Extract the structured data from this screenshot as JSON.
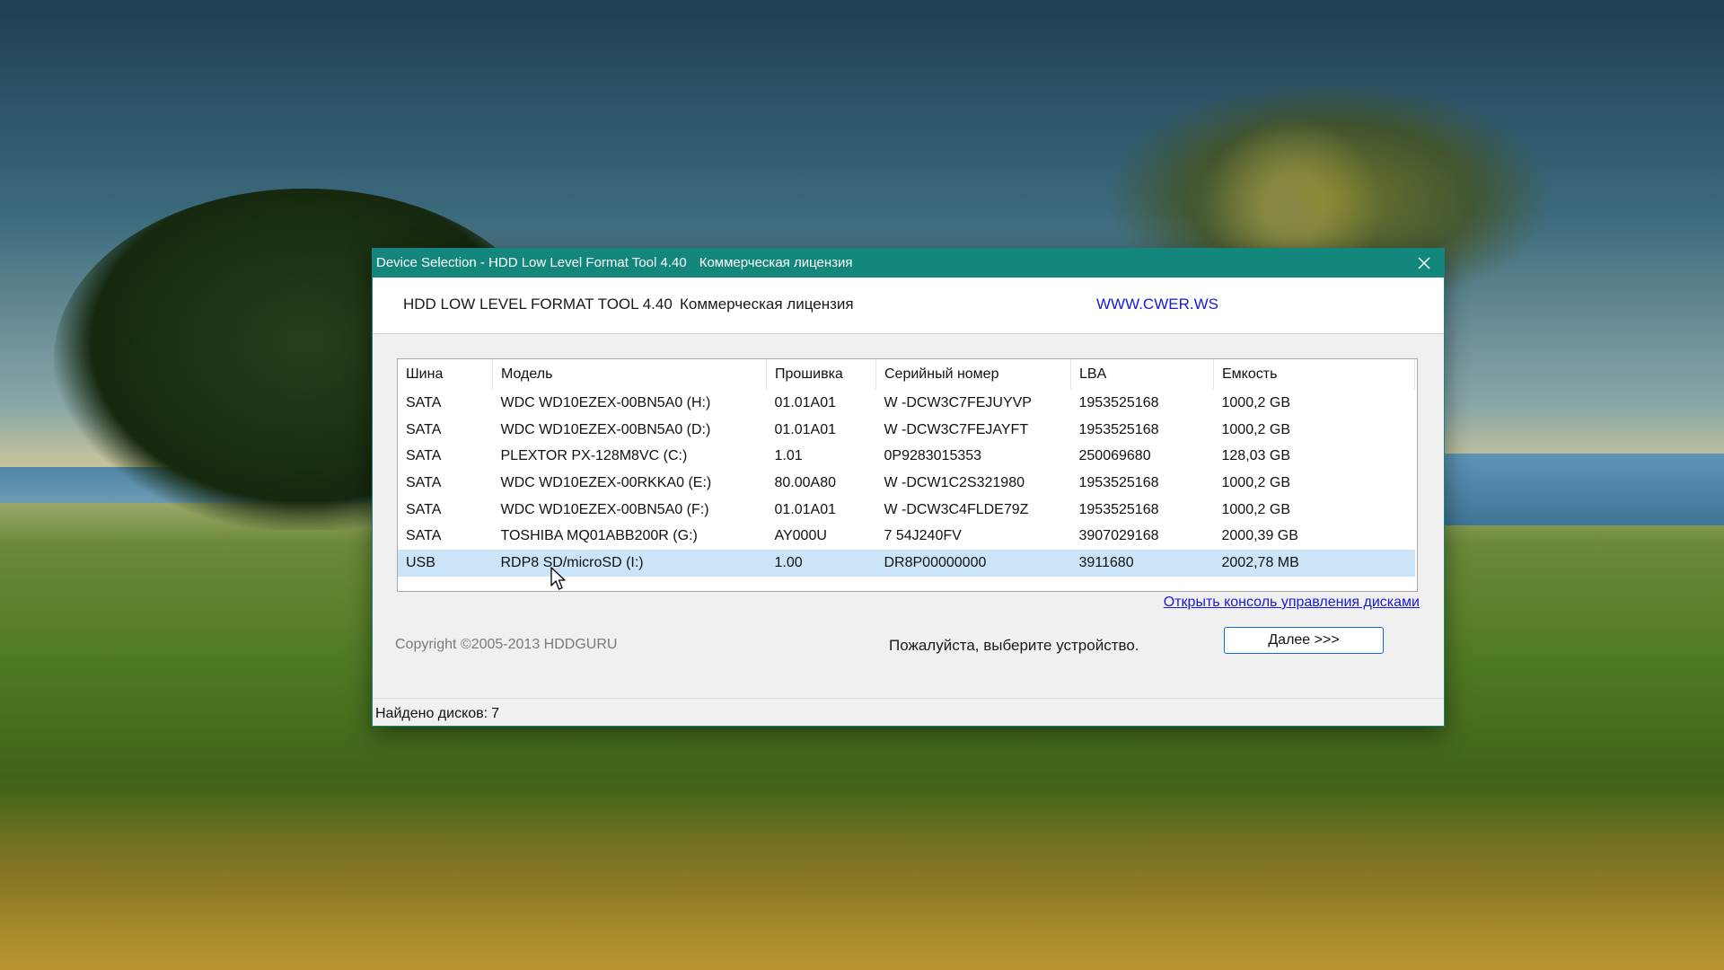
{
  "window": {
    "title": "Device Selection - HDD Low Level Format Tool 4.40",
    "title_license": "Коммерческая лицензия"
  },
  "header": {
    "app_name": "HDD LOW LEVEL FORMAT TOOL 4.40",
    "license": "Коммерческая лицензия",
    "site": "WWW.CWER.WS"
  },
  "table": {
    "columns": [
      "Шина",
      "Модель",
      "Прошивка",
      "Серийный номер",
      "LBA",
      "Емкость"
    ],
    "rows": [
      [
        "SATA",
        "WDC WD10EZEX-00BN5A0 (H:)",
        "01.01A01",
        "W -DCW3C7FEJUYVP",
        "1953525168",
        "1000,2 GB"
      ],
      [
        "SATA",
        "WDC WD10EZEX-00BN5A0 (D:)",
        "01.01A01",
        "W -DCW3C7FEJAYFT",
        "1953525168",
        "1000,2 GB"
      ],
      [
        "SATA",
        "PLEXTOR PX-128M8VC (C:)",
        "1.01",
        "0P9283015353",
        "250069680",
        "128,03 GB"
      ],
      [
        "SATA",
        "WDC WD10EZEX-00RKKA0 (E:)",
        "80.00A80",
        "W -DCW1C2S321980",
        "1953525168",
        "1000,2 GB"
      ],
      [
        "SATA",
        "WDC WD10EZEX-00BN5A0 (F:)",
        "01.01A01",
        "W -DCW3C4FLDE79Z",
        "1953525168",
        "1000,2 GB"
      ],
      [
        "SATA",
        "TOSHIBA MQ01ABB200R (G:)",
        "AY000U",
        "7 54J240FV",
        "3907029168",
        "2000,39 GB"
      ],
      [
        "USB",
        "RDP8 SD/microSD (I:)",
        "1.00",
        "DR8P00000000",
        "3911680",
        "2002,78 MB"
      ]
    ]
  },
  "links": {
    "disk_management": "Открыть консоль управления дисками"
  },
  "footer": {
    "copyright": "Copyright ©2005-2013 HDDGURU",
    "prompt": "Пожалуйста, выберите устройство.",
    "next_button": "Далее >>>"
  },
  "status": {
    "label": "Найдено дисков:",
    "count": "7"
  },
  "colors": {
    "titlebar": "#14877d",
    "link": "#1a1ad8",
    "selected_row": "#cce4f7"
  }
}
